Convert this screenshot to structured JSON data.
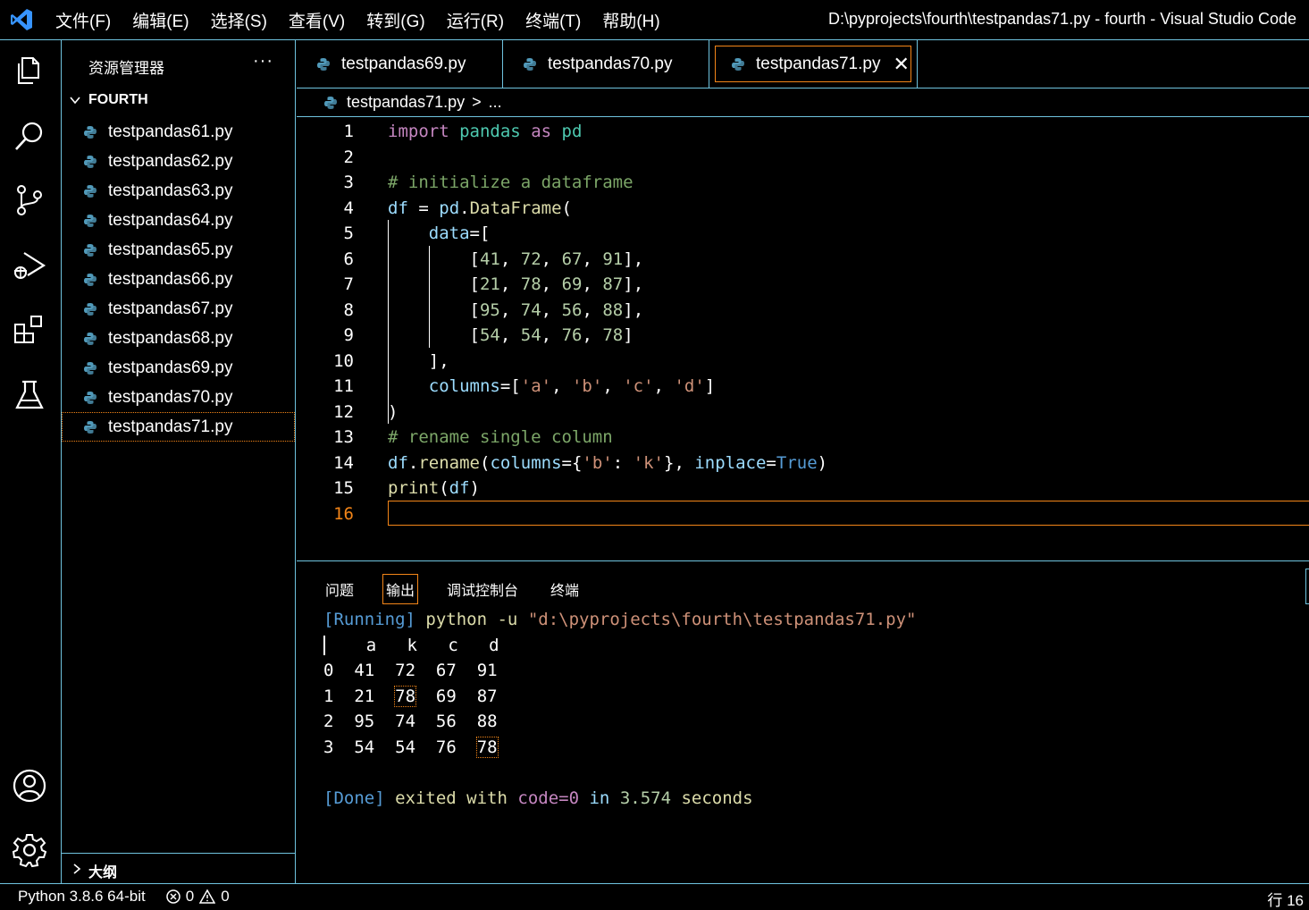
{
  "titlebar": {
    "menu": [
      "文件(F)",
      "编辑(E)",
      "选择(S)",
      "查看(V)",
      "转到(G)",
      "运行(R)",
      "终端(T)",
      "帮助(H)"
    ],
    "window_title": "D:\\pyprojects\\fourth\\testpandas71.py - fourth - Visual Studio Code"
  },
  "activitybar": {
    "icons": [
      "explorer-icon",
      "search-icon",
      "source-control-icon",
      "run-debug-icon",
      "extensions-icon",
      "testing-icon",
      "account-icon",
      "settings-gear-icon"
    ]
  },
  "sidebar": {
    "title": "资源管理器",
    "more": "···",
    "folder": "FOURTH",
    "files": [
      "testpandas61.py",
      "testpandas62.py",
      "testpandas63.py",
      "testpandas64.py",
      "testpandas65.py",
      "testpandas66.py",
      "testpandas67.py",
      "testpandas68.py",
      "testpandas69.py",
      "testpandas70.py",
      "testpandas71.py"
    ],
    "active_file": "testpandas71.py",
    "outline": "大纲"
  },
  "tabs": [
    {
      "label": "testpandas69.py",
      "active": false
    },
    {
      "label": "testpandas70.py",
      "active": false
    },
    {
      "label": "testpandas71.py",
      "active": true
    }
  ],
  "breadcrumb": {
    "file": "testpandas71.py",
    "sep": ">",
    "rest": "..."
  },
  "editor": {
    "current_line": 16,
    "line_numbers": [
      "1",
      "2",
      "3",
      "4",
      "5",
      "6",
      "7",
      "8",
      "9",
      "10",
      "11",
      "12",
      "13",
      "14",
      "15",
      "16"
    ],
    "code": [
      "import pandas as pd",
      "",
      "# initialize a dataframe",
      "df = pd.DataFrame(",
      "    data=[",
      "        [41, 72, 67, 91],",
      "        [21, 78, 69, 87],",
      "        [95, 74, 56, 88],",
      "        [54, 54, 76, 78]",
      "    ],",
      "    columns=['a', 'b', 'c', 'd']",
      ")",
      "# rename single column",
      "df.rename(columns={'b': 'k'}, inplace=True)",
      "print(df)",
      ""
    ]
  },
  "panel": {
    "tabs": [
      "问题",
      "输出",
      "调试控制台",
      "终端"
    ],
    "active_tab": "输出",
    "output": {
      "running_tag": "[Running]",
      "running_cmd": "python -u",
      "running_path": "\"d:\\pyprojects\\fourth\\testpandas71.py\"",
      "table_header": [
        "a",
        "k",
        "c",
        "d"
      ],
      "table_rows": [
        {
          "index": "0",
          "values": [
            "41",
            "72",
            "67",
            "91"
          ]
        },
        {
          "index": "1",
          "values": [
            "21",
            "78",
            "69",
            "87"
          ]
        },
        {
          "index": "2",
          "values": [
            "95",
            "74",
            "56",
            "88"
          ]
        },
        {
          "index": "3",
          "values": [
            "54",
            "54",
            "76",
            "78"
          ]
        }
      ],
      "done_tag": "[Done]",
      "done_text1": "exited with",
      "done_code": "code=0",
      "done_text2": "in",
      "done_time": "3.574",
      "done_text3": "seconds"
    }
  },
  "statusbar": {
    "python": "Python 3.8.6 64-bit",
    "errors": "0",
    "warnings": "0",
    "position": "行 16"
  },
  "colors": {
    "border": "#6fc3df",
    "focus": "#f38518"
  }
}
